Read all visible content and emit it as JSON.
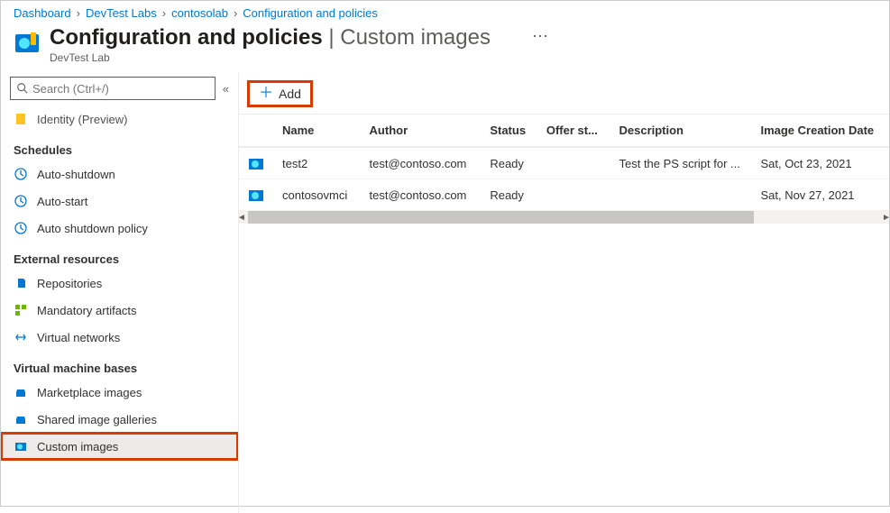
{
  "breadcrumb": [
    {
      "label": "Dashboard"
    },
    {
      "label": "DevTest Labs"
    },
    {
      "label": "contosolab"
    },
    {
      "label": "Configuration and policies"
    }
  ],
  "header": {
    "title_main": "Configuration and policies",
    "title_section": "Custom images",
    "subtitle": "DevTest Lab"
  },
  "search": {
    "placeholder": "Search (Ctrl+/)"
  },
  "sidebar": {
    "top_item": {
      "label": "Identity (Preview)"
    },
    "groups": [
      {
        "label": "Schedules",
        "items": [
          {
            "label": "Auto-shutdown",
            "icon": "clock-icon"
          },
          {
            "label": "Auto-start",
            "icon": "clock-icon"
          },
          {
            "label": "Auto shutdown policy",
            "icon": "clock-icon"
          }
        ]
      },
      {
        "label": "External resources",
        "items": [
          {
            "label": "Repositories",
            "icon": "repo-icon"
          },
          {
            "label": "Mandatory artifacts",
            "icon": "artifacts-icon"
          },
          {
            "label": "Virtual networks",
            "icon": "vnet-icon"
          }
        ]
      },
      {
        "label": "Virtual machine bases",
        "items": [
          {
            "label": "Marketplace images",
            "icon": "marketplace-icon"
          },
          {
            "label": "Shared image galleries",
            "icon": "gallery-icon"
          },
          {
            "label": "Custom images",
            "icon": "custom-image-icon",
            "selected": true,
            "highlight": true
          }
        ]
      }
    ]
  },
  "toolbar": {
    "add_label": "Add"
  },
  "grid": {
    "columns": [
      "Name",
      "Author",
      "Status",
      "Offer st...",
      "Description",
      "Image Creation Date"
    ],
    "rows": [
      {
        "name": "test2",
        "author": "test@contoso.com",
        "status": "Ready",
        "offer": "",
        "description": "Test the PS script for ...",
        "created": "Sat, Oct 23, 2021"
      },
      {
        "name": "contosovmci",
        "author": "test@contoso.com",
        "status": "Ready",
        "offer": "",
        "description": "",
        "created": "Sat, Nov 27, 2021"
      }
    ]
  }
}
